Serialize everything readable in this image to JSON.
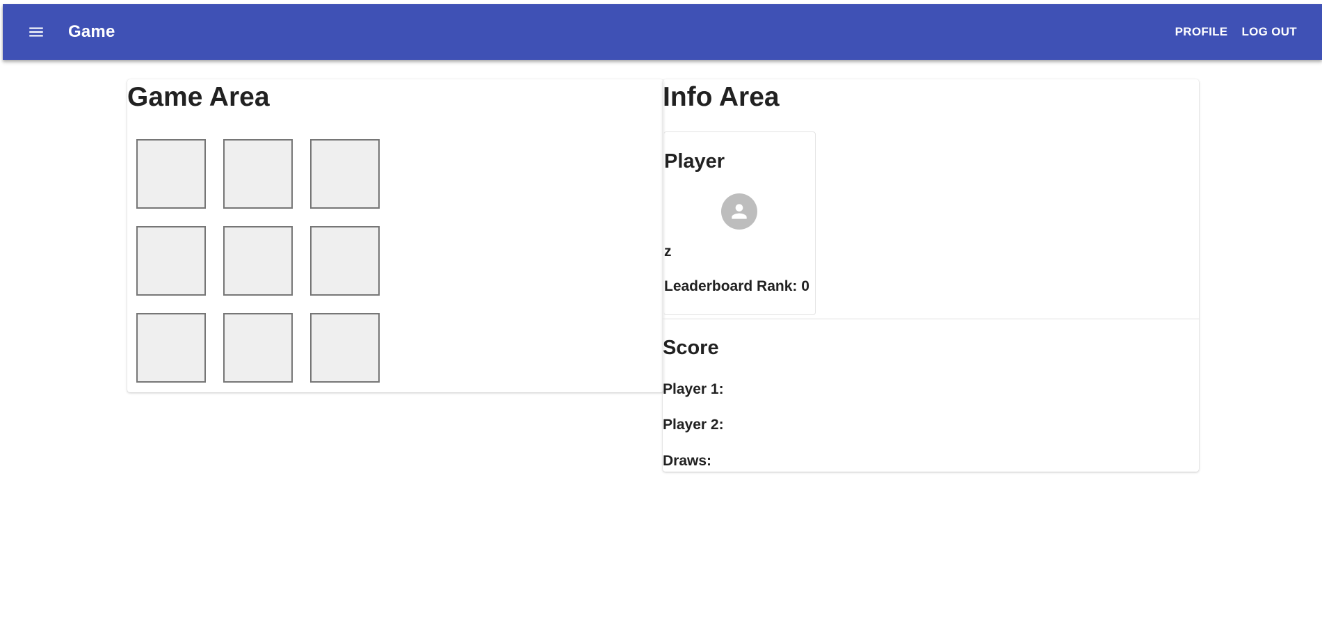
{
  "app_bar": {
    "title": "Game",
    "menu_icon": "menu-icon",
    "profile_label": "PROFILE",
    "logout_label": "LOG OUT",
    "background_color": "#3f51b5"
  },
  "game_area": {
    "title": "Game Area",
    "board": [
      "",
      "",
      "",
      "",
      "",
      "",
      "",
      "",
      ""
    ]
  },
  "info_area": {
    "title": "Info Area",
    "player": {
      "heading": "Player",
      "avatar_icon": "person-icon",
      "name": "z",
      "rank_label": "Leaderboard Rank: 0"
    },
    "score": {
      "heading": "Score",
      "player1_label": "Player 1:",
      "player2_label": "Player 2:",
      "draws_label": "Draws:"
    }
  }
}
